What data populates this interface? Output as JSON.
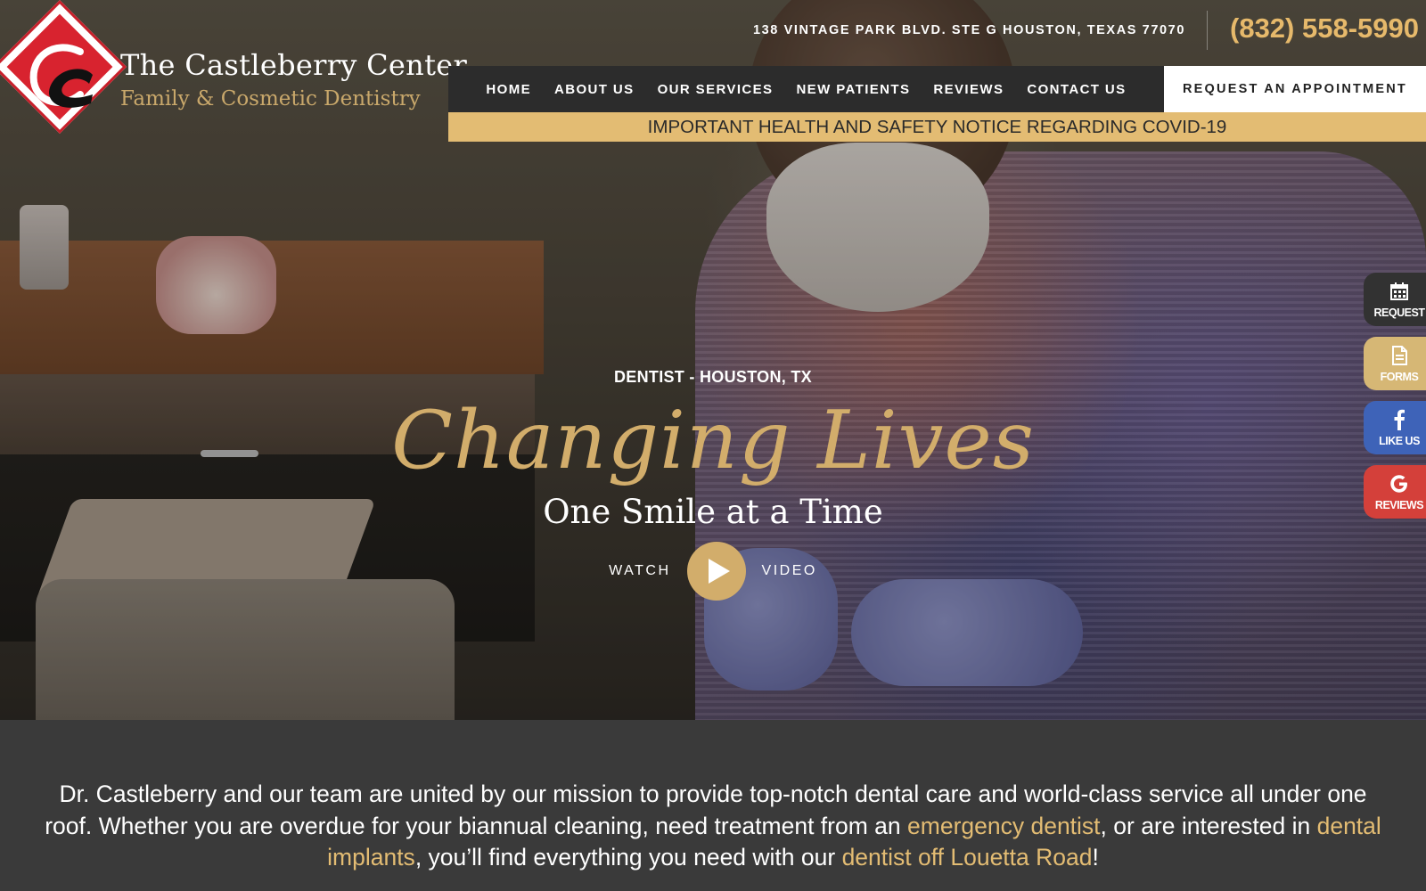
{
  "brand": {
    "title": "The Castleberry Center",
    "subtitle": "Family & Cosmetic Dentistry",
    "accent_gold": "#e3bc73",
    "logo_red": "#d8232f"
  },
  "contact": {
    "address": "138 VINTAGE PARK BLVD. STE G HOUSTON, TEXAS 77070",
    "phone": "(832) 558-5990"
  },
  "nav": {
    "items": [
      "HOME",
      "ABOUT US",
      "OUR SERVICES",
      "NEW PATIENTS",
      "REVIEWS",
      "CONTACT US"
    ],
    "cta": "REQUEST AN APPOINTMENT"
  },
  "notice": "IMPORTANT HEALTH AND SAFETY NOTICE REGARDING COVID-19",
  "hero": {
    "eyebrow": "DENTIST - HOUSTON, TX",
    "headline": "Changing Lives",
    "subhead": "One Smile at a Time",
    "watch": "WATCH",
    "video": "VIDEO"
  },
  "side_tabs": [
    {
      "label": "REQUEST",
      "icon": "calendar-icon"
    },
    {
      "label": "FORMS",
      "icon": "document-icon"
    },
    {
      "label": "LIKE US",
      "icon": "facebook-icon"
    },
    {
      "label": "REVIEWS",
      "icon": "google-icon"
    }
  ],
  "intro": {
    "part1": "Dr. Castleberry and our team are united by our mission to provide top-notch dental care and world-class service all under one roof. Whether you are overdue for your biannual cleaning, need treatment from an ",
    "link1": "emergency dentist",
    "part2": ", or are interested in ",
    "link2": "dental implants",
    "part3": ", you’ll find everything you need with our ",
    "link3": "dentist off Louetta Road",
    "part4": "!"
  }
}
